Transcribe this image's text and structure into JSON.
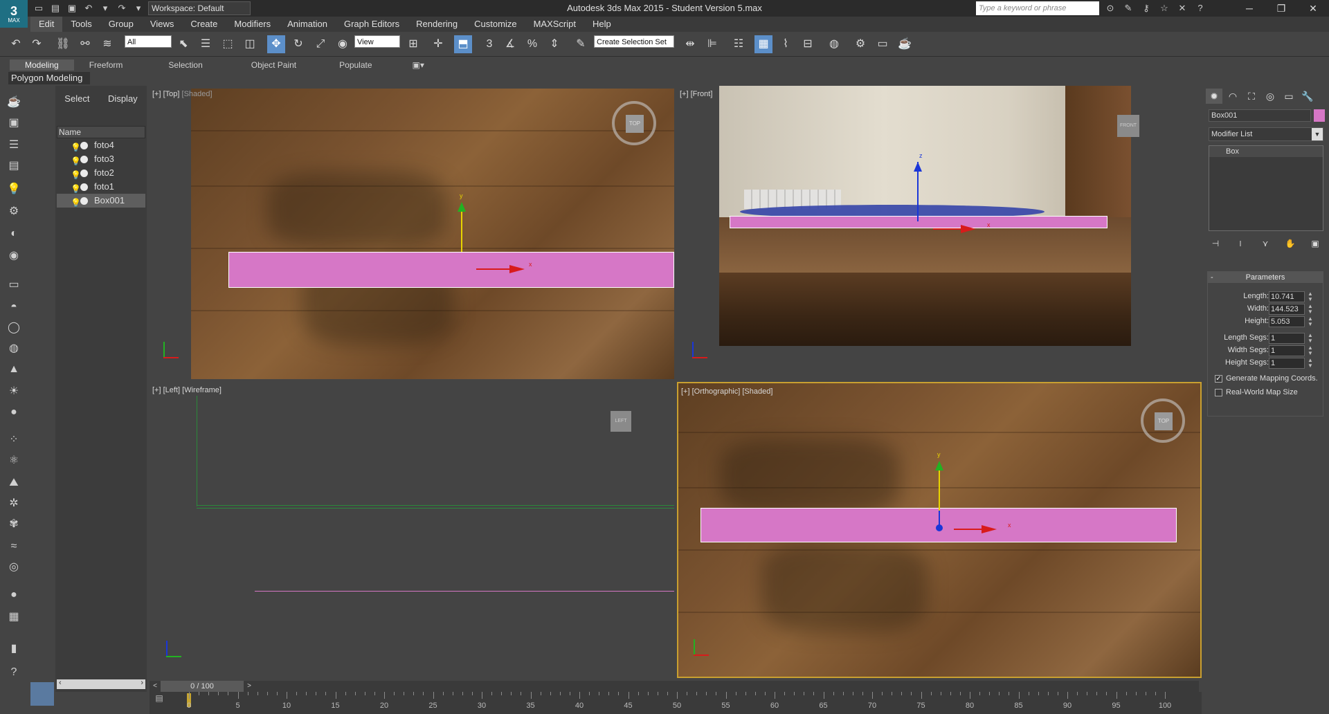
{
  "app": {
    "title": "Autodesk 3ds Max  2015   - Student Version     5.max",
    "logo_text": "MAX",
    "workspace": "Workspace: Default",
    "search_placeholder": "Type a keyword or phrase"
  },
  "menu": [
    "Edit",
    "Tools",
    "Group",
    "Views",
    "Create",
    "Modifiers",
    "Animation",
    "Graph Editors",
    "Rendering",
    "Customize",
    "MAXScript",
    "Help"
  ],
  "toolbar": {
    "selection_filter": "All",
    "reference_coord": "View",
    "snap_angle": "3",
    "named_selection": "Create Selection Set"
  },
  "ribbon": {
    "tabs": [
      "Modeling",
      "Freeform",
      "Selection",
      "Object Paint",
      "Populate"
    ],
    "active_tab": "Modeling",
    "panel": "Polygon Modeling"
  },
  "explorer": {
    "tabs": [
      "Select",
      "Display"
    ],
    "column_header": "Name",
    "items": [
      "foto4",
      "foto3",
      "foto2",
      "foto1",
      "Box001"
    ],
    "selected": "Box001"
  },
  "viewports": {
    "top": {
      "label_plus": "[+]",
      "label_view": "[Top]",
      "label_shade": "[Shaded]",
      "cube": "TOP"
    },
    "front": {
      "label_plus": "[+]",
      "label_view": "[Front]",
      "cube": "FRONT"
    },
    "left": {
      "label_plus": "[+]",
      "label_view": "[Left]",
      "label_shade": "[Wireframe]",
      "cube": "LEFT"
    },
    "ortho": {
      "label_plus": "[+]",
      "label_view": "[Orthographic]",
      "label_shade": "[Shaded]",
      "cube": "TOP"
    }
  },
  "axes": {
    "x": "x",
    "y": "y",
    "z": "z"
  },
  "command_panel": {
    "object_name": "Box001",
    "object_color": "#d677c6",
    "modifier_list": "Modifier List",
    "stack": [
      "Box"
    ],
    "rollout_title": "Parameters",
    "rollout_toggle": "-",
    "params": [
      {
        "label": "Length:",
        "value": "10.741"
      },
      {
        "label": "Width:",
        "value": "144.523"
      },
      {
        "label": "Height:",
        "value": "5.053"
      },
      {
        "label": "Length Segs:",
        "value": "1"
      },
      {
        "label": "Width Segs:",
        "value": "1"
      },
      {
        "label": "Height Segs:",
        "value": "1"
      }
    ],
    "checkboxes": [
      {
        "label": "Generate Mapping Coords.",
        "checked": true
      },
      {
        "label": "Real-World Map Size",
        "checked": false
      }
    ]
  },
  "timeline": {
    "frame_display": "0 / 100",
    "ticks": [
      "0",
      "5",
      "10",
      "15",
      "20",
      "25",
      "30",
      "35",
      "40",
      "45",
      "50",
      "55",
      "60",
      "65",
      "70",
      "75",
      "80",
      "85",
      "90",
      "95",
      "100"
    ]
  },
  "colors": {
    "box": "#d677c6",
    "active_tool": "#5c8fc9",
    "ortho_frame": "#c9a030"
  }
}
